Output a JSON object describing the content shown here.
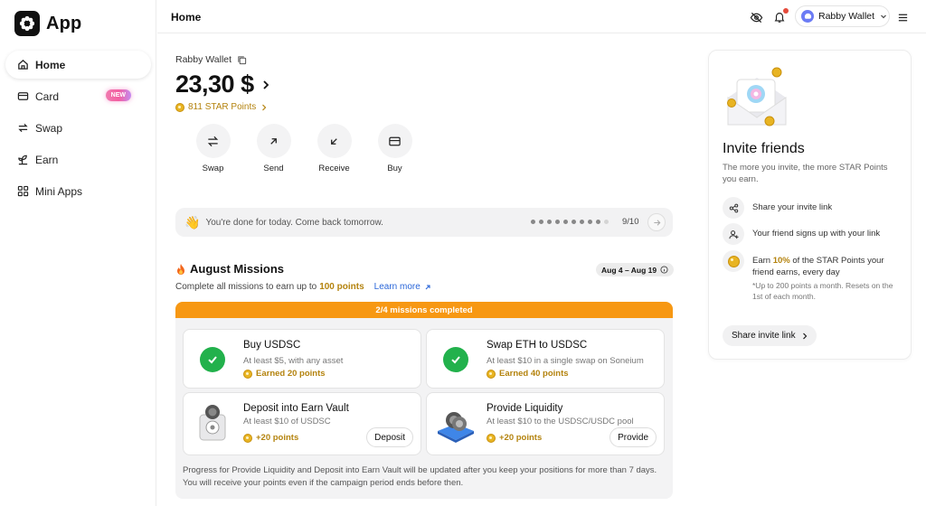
{
  "app": {
    "name": "App"
  },
  "sidebar": {
    "items": [
      {
        "label": "Home",
        "icon": "home-icon",
        "active": true
      },
      {
        "label": "Card",
        "icon": "card-icon",
        "badge": "NEW"
      },
      {
        "label": "Swap",
        "icon": "swap-icon"
      },
      {
        "label": "Earn",
        "icon": "sprout-icon"
      },
      {
        "label": "Mini Apps",
        "icon": "grid-icon"
      }
    ]
  },
  "header": {
    "title": "Home",
    "wallet_name": "Rabby Wallet",
    "icons": [
      "eye-off-icon",
      "bell-icon",
      "menu-icon"
    ]
  },
  "wallet": {
    "label": "Rabby Wallet",
    "balance": "23,30 $",
    "star_points": "811 STAR Points"
  },
  "actions": [
    {
      "label": "Swap",
      "icon": "swap-icon"
    },
    {
      "label": "Send",
      "icon": "arrow-up-right-icon"
    },
    {
      "label": "Receive",
      "icon": "arrow-down-left-icon"
    },
    {
      "label": "Buy",
      "icon": "card-icon"
    }
  ],
  "daily": {
    "message": "You're done for today. Come back tomorrow.",
    "count": "9/10",
    "completed": 9,
    "total": 10
  },
  "missions": {
    "title": "August Missions",
    "dates": "Aug 4 – Aug 19",
    "subtitle_prefix": "Complete all missions to earn up to",
    "subtitle_points": "100 points",
    "learn_more": "Learn more",
    "progress": "2/4 missions completed",
    "items": [
      {
        "title": "Buy USDSC",
        "sub": "At least $5, with any asset",
        "points": "Earned 20 points",
        "done": true
      },
      {
        "title": "Swap ETH to USDSC",
        "sub": "At least $10 in a single swap on Soneium",
        "points": "Earned 40 points",
        "done": true
      },
      {
        "title": "Deposit into Earn Vault",
        "sub": "At least $10 of USDSC",
        "points": "+20 points",
        "button": "Deposit"
      },
      {
        "title": "Provide Liquidity",
        "sub": "At least $10 to the USDSC/USDC pool",
        "points": "+20 points",
        "button": "Provide"
      }
    ],
    "note": "Progress for Provide Liquidity and Deposit into Earn Vault will be updated after you keep your positions for more than 7 days. You will receive your points even if the campaign period ends before then."
  },
  "invite": {
    "title": "Invite friends",
    "desc": "The more you invite, the more STAR Points you earn.",
    "step1": "Share your invite link",
    "step2": "Your friend signs up with your link",
    "step3_prefix": "Earn",
    "step3_pct": "10%",
    "step3_suffix": "of the STAR Points your friend earns, every day",
    "step3_foot": "*Up to 200 points a month. Resets on the 1st of each month.",
    "button": "Share invite link"
  },
  "colors": {
    "accent_orange": "#f79813",
    "gold": "#b4830e",
    "success": "#22b14c",
    "link": "#2a66d9"
  }
}
